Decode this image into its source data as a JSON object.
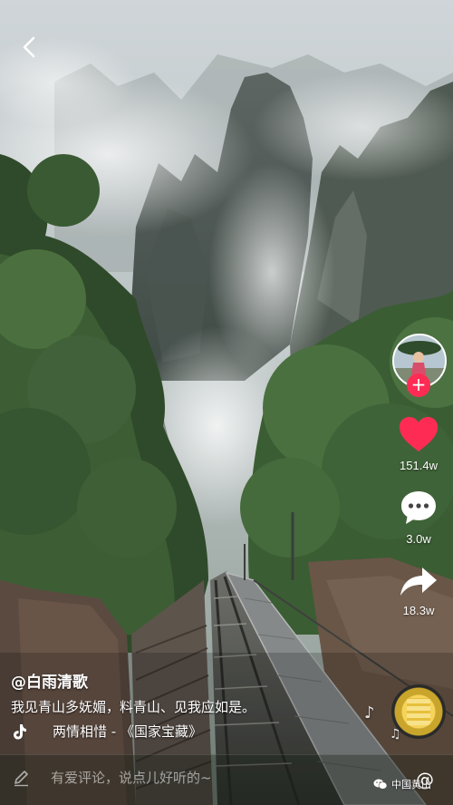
{
  "video": {
    "username": "@白雨清歌",
    "description": "我见青山多妩媚，料青山、见我应如是。",
    "music": "两情相惜 - 《国家宝藏》"
  },
  "actions": {
    "likes": "151.4w",
    "comments": "3.0w",
    "shares": "18.3w"
  },
  "comment_bar": {
    "placeholder": "有爱评论，说点儿好听的~"
  },
  "watermark": {
    "text": "中国黄山"
  },
  "icons": {
    "back": "chevron-left-icon",
    "heart": "heart-icon",
    "comment": "speech-bubble-icon",
    "share": "share-arrow-icon",
    "follow": "plus-icon",
    "tiktok": "tiktok-note-icon",
    "pencil": "pencil-icon",
    "mention": "at-icon",
    "wechat": "wechat-icon"
  },
  "colors": {
    "like_red": "#fe2c55",
    "follow_red": "#fe2c55",
    "text": "#ffffff"
  }
}
